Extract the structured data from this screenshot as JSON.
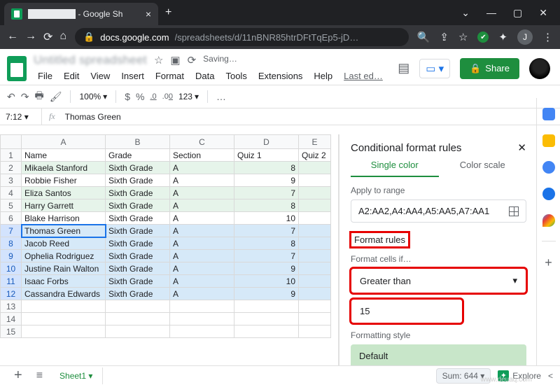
{
  "browser": {
    "tab_title": "████████ - Google Sh",
    "url_domain": "docs.google.com",
    "url_path": "/spreadsheets/d/11nBNR85htrDFtTqEp5-jD…",
    "avatar_letter": "J"
  },
  "header": {
    "doc_title": "Untitled spreadsheet",
    "saving": "Saving…",
    "share": "Share",
    "last_edit": "Last ed…"
  },
  "menu": [
    "File",
    "Edit",
    "View",
    "Insert",
    "Format",
    "Data",
    "Tools",
    "Extensions",
    "Help"
  ],
  "toolbar": {
    "zoom": "100%",
    "currency": "$",
    "percent": "%",
    "dec_dec": ".0",
    "dec_inc": ".00",
    "num_fmt": "123",
    "more": "…"
  },
  "formula": {
    "name_box": "7:12",
    "fx": "fx",
    "value": "Thomas Green"
  },
  "columns": [
    "A",
    "B",
    "C",
    "D",
    "E"
  ],
  "headers": [
    "Name",
    "Grade",
    "Section",
    "Quiz 1",
    "Quiz 2"
  ],
  "rows": [
    {
      "n": 2,
      "name": "Mikaela Stanford",
      "grade": "Sixth Grade",
      "section": "A",
      "q1": "8",
      "sel": true
    },
    {
      "n": 3,
      "name": "Robbie Fisher",
      "grade": "Sixth Grade",
      "section": "A",
      "q1": "9",
      "sel": false
    },
    {
      "n": 4,
      "name": "Eliza Santos",
      "grade": "Sixth Grade",
      "section": "A",
      "q1": "7",
      "sel": true
    },
    {
      "n": 5,
      "name": "Harry Garrett",
      "grade": "Sixth Grade",
      "section": "A",
      "q1": "8",
      "sel": true
    },
    {
      "n": 6,
      "name": "Blake Harrison",
      "grade": "Sixth Grade",
      "section": "A",
      "q1": "10",
      "sel": false
    },
    {
      "n": 7,
      "name": "Thomas Green",
      "grade": "Sixth Grade",
      "section": "A",
      "q1": "7",
      "sel": true,
      "range": true,
      "active": true
    },
    {
      "n": 8,
      "name": "Jacob Reed",
      "grade": "Sixth Grade",
      "section": "A",
      "q1": "8",
      "sel": false,
      "range": true
    },
    {
      "n": 9,
      "name": "Ophelia Rodriguez",
      "grade": "Sixth Grade",
      "section": "A",
      "q1": "7",
      "sel": true,
      "range": true
    },
    {
      "n": 10,
      "name": "Justine Rain Walton",
      "grade": "Sixth Grade",
      "section": "A",
      "q1": "9",
      "sel": true,
      "range": true
    },
    {
      "n": 11,
      "name": "Isaac Forbs",
      "grade": "Sixth Grade",
      "section": "A",
      "q1": "10",
      "sel": false,
      "range": true
    },
    {
      "n": 12,
      "name": "Cassandra Edwards",
      "grade": "Sixth Grade",
      "section": "A",
      "q1": "9",
      "sel": true,
      "range": true
    },
    {
      "n": 13,
      "name": "",
      "grade": "",
      "section": "",
      "q1": "",
      "sel": false
    },
    {
      "n": 14,
      "name": "",
      "grade": "",
      "section": "",
      "q1": "",
      "sel": false
    },
    {
      "n": 15,
      "name": "",
      "grade": "",
      "section": "",
      "q1": "",
      "sel": false
    }
  ],
  "panel": {
    "title": "Conditional format rules",
    "tab_single": "Single color",
    "tab_scale": "Color scale",
    "apply_label": "Apply to range",
    "range": "A2:AA2,A4:AA4,A5:AA5,A7:AA1",
    "rules_header": "Format rules",
    "cells_if": "Format cells if…",
    "condition": "Greater than",
    "value": "15",
    "style_label": "Formatting style",
    "default": "Default"
  },
  "sidebar_chips": [
    {
      "color": "#4285f4"
    },
    {
      "color": "#fbbc04"
    },
    {
      "color": "#4285f4"
    },
    {
      "color": "#1a73e8"
    },
    {
      "color": "#ea4335"
    }
  ],
  "bottom": {
    "sheet": "Sheet1",
    "sum": "Sum: 644",
    "explore": "Explore"
  },
  "watermark": "www.deuaq.com"
}
